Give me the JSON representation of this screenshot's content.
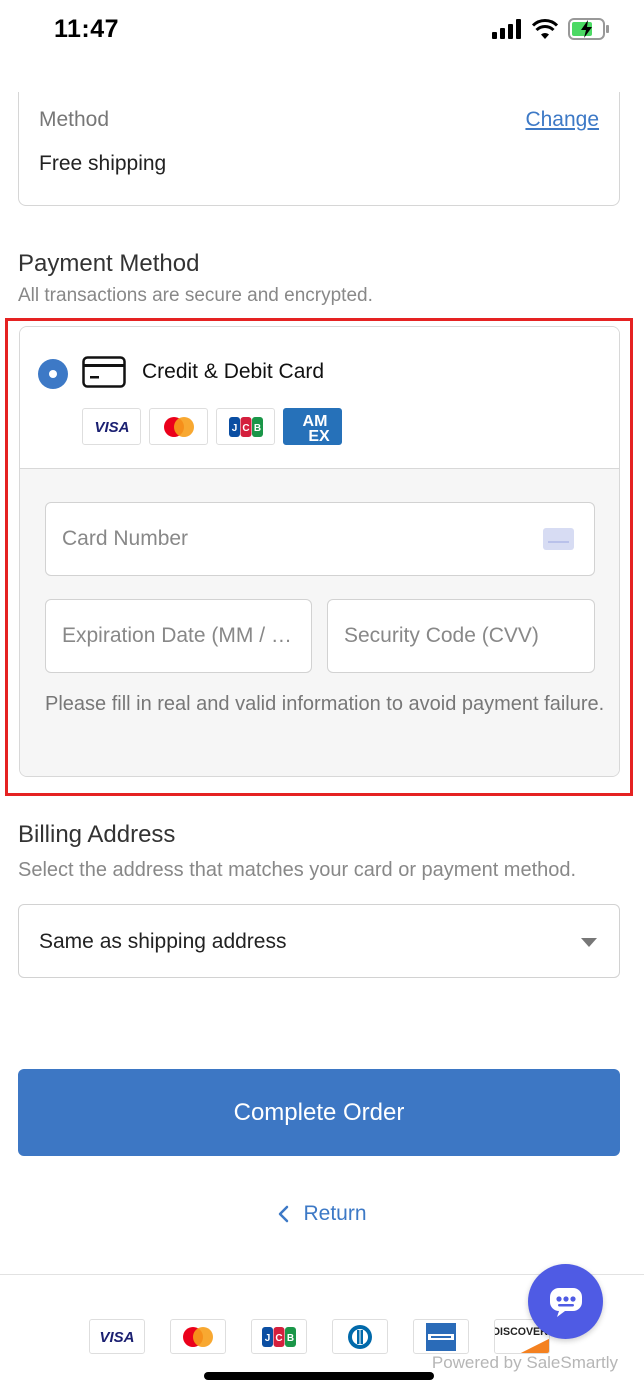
{
  "status_bar": {
    "time": "11:47"
  },
  "shipping": {
    "method_label": "Method",
    "change_label": "Change",
    "method_value": "Free shipping"
  },
  "payment": {
    "title": "Payment Method",
    "subtitle": "All transactions are secure and encrypted.",
    "option_label": "Credit & Debit Card",
    "brands": [
      "VISA",
      "Mastercard",
      "JCB",
      "AMEX"
    ],
    "card_number_placeholder": "Card Number",
    "expiration_placeholder": "Expiration Date (MM / …",
    "cvv_placeholder": "Security Code (CVV)",
    "warning": "Please fill in real and valid information to avoid payment failure."
  },
  "billing": {
    "title": "Billing Address",
    "subtitle": "Select the address that matches your card or payment method.",
    "selected": "Same as shipping address"
  },
  "actions": {
    "complete_label": "Complete Order",
    "return_label": "Return"
  },
  "footer": {
    "brands": [
      "VISA",
      "Mastercard",
      "JCB",
      "Diners Club",
      "American Express",
      "DISCOVER"
    ],
    "powered_by": "Powered by SaleSmartly"
  },
  "colors": {
    "accent": "#3d77c4",
    "highlight": "#e52222",
    "chat": "#4f5be4"
  }
}
